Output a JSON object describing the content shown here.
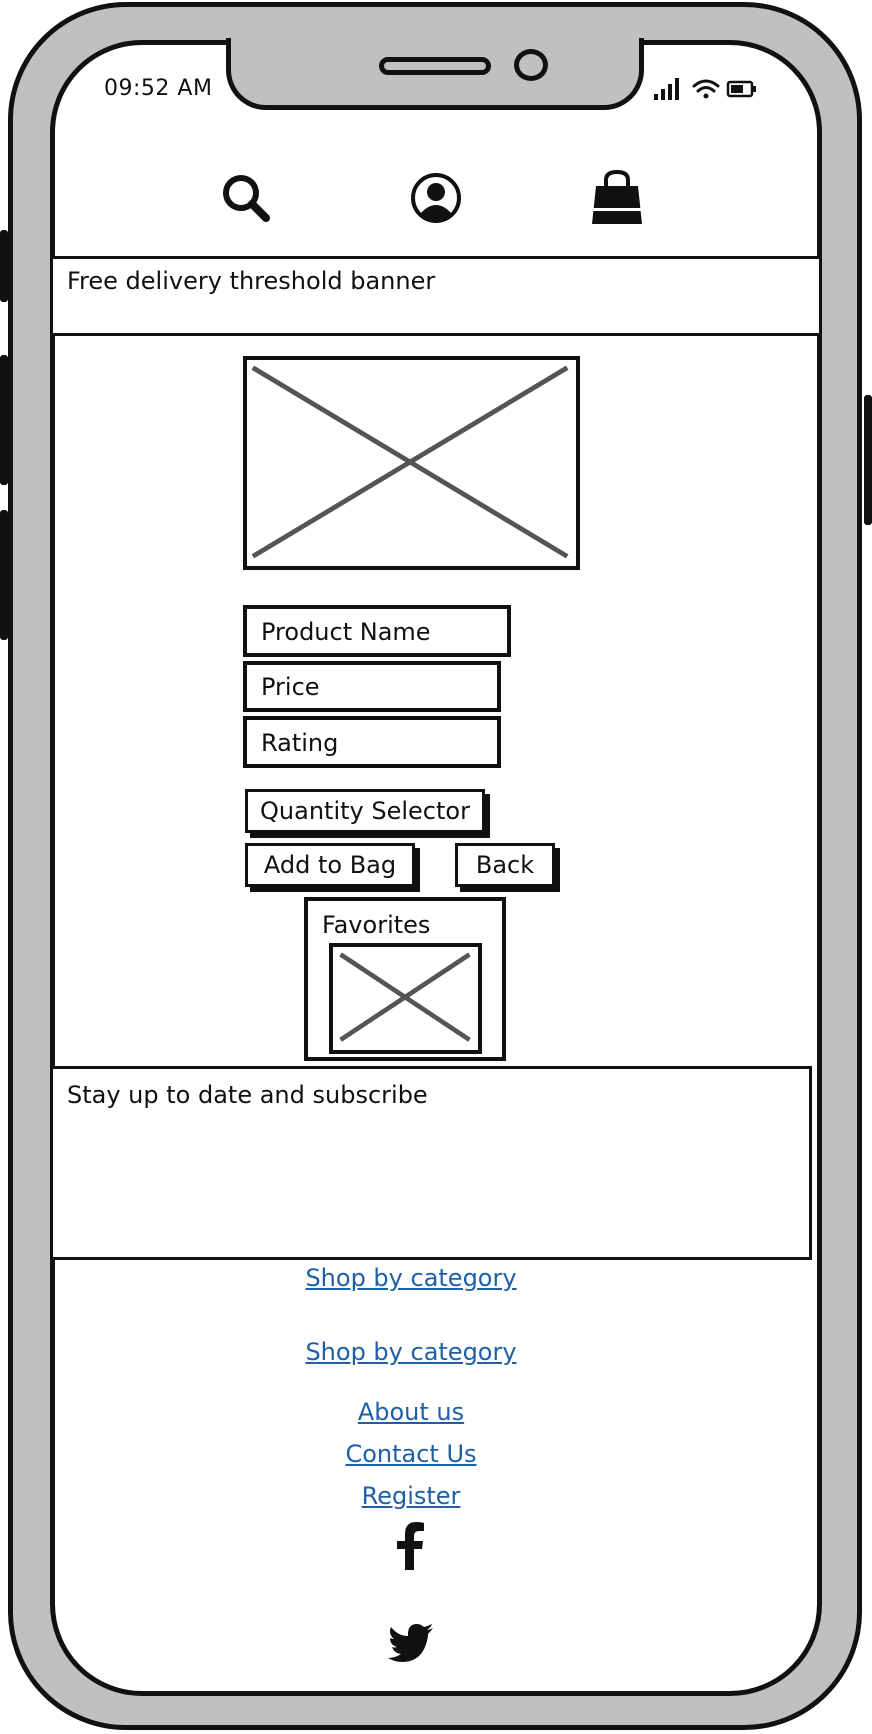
{
  "status_bar": {
    "time": "09:52 AM"
  },
  "header": {
    "icons": [
      "search-icon",
      "user-account-icon",
      "shopping-bag-icon"
    ]
  },
  "banner": {
    "text": "Free delivery threshold banner"
  },
  "product": {
    "name": "Product Name",
    "price": "Price",
    "rating": "Rating",
    "quantity_selector": "Quantity Selector",
    "add_to_bag": "Add to Bag",
    "back": "Back",
    "favorites": "Favorites"
  },
  "subscribe": {
    "text": "Stay up to date and subscribe"
  },
  "footer": {
    "links": [
      "Shop by category",
      "Shop by category",
      "About us",
      "Contact Us",
      "Register"
    ],
    "social": [
      "facebook-icon",
      "twitter-icon"
    ],
    "link_color": "#1e5fa6"
  }
}
